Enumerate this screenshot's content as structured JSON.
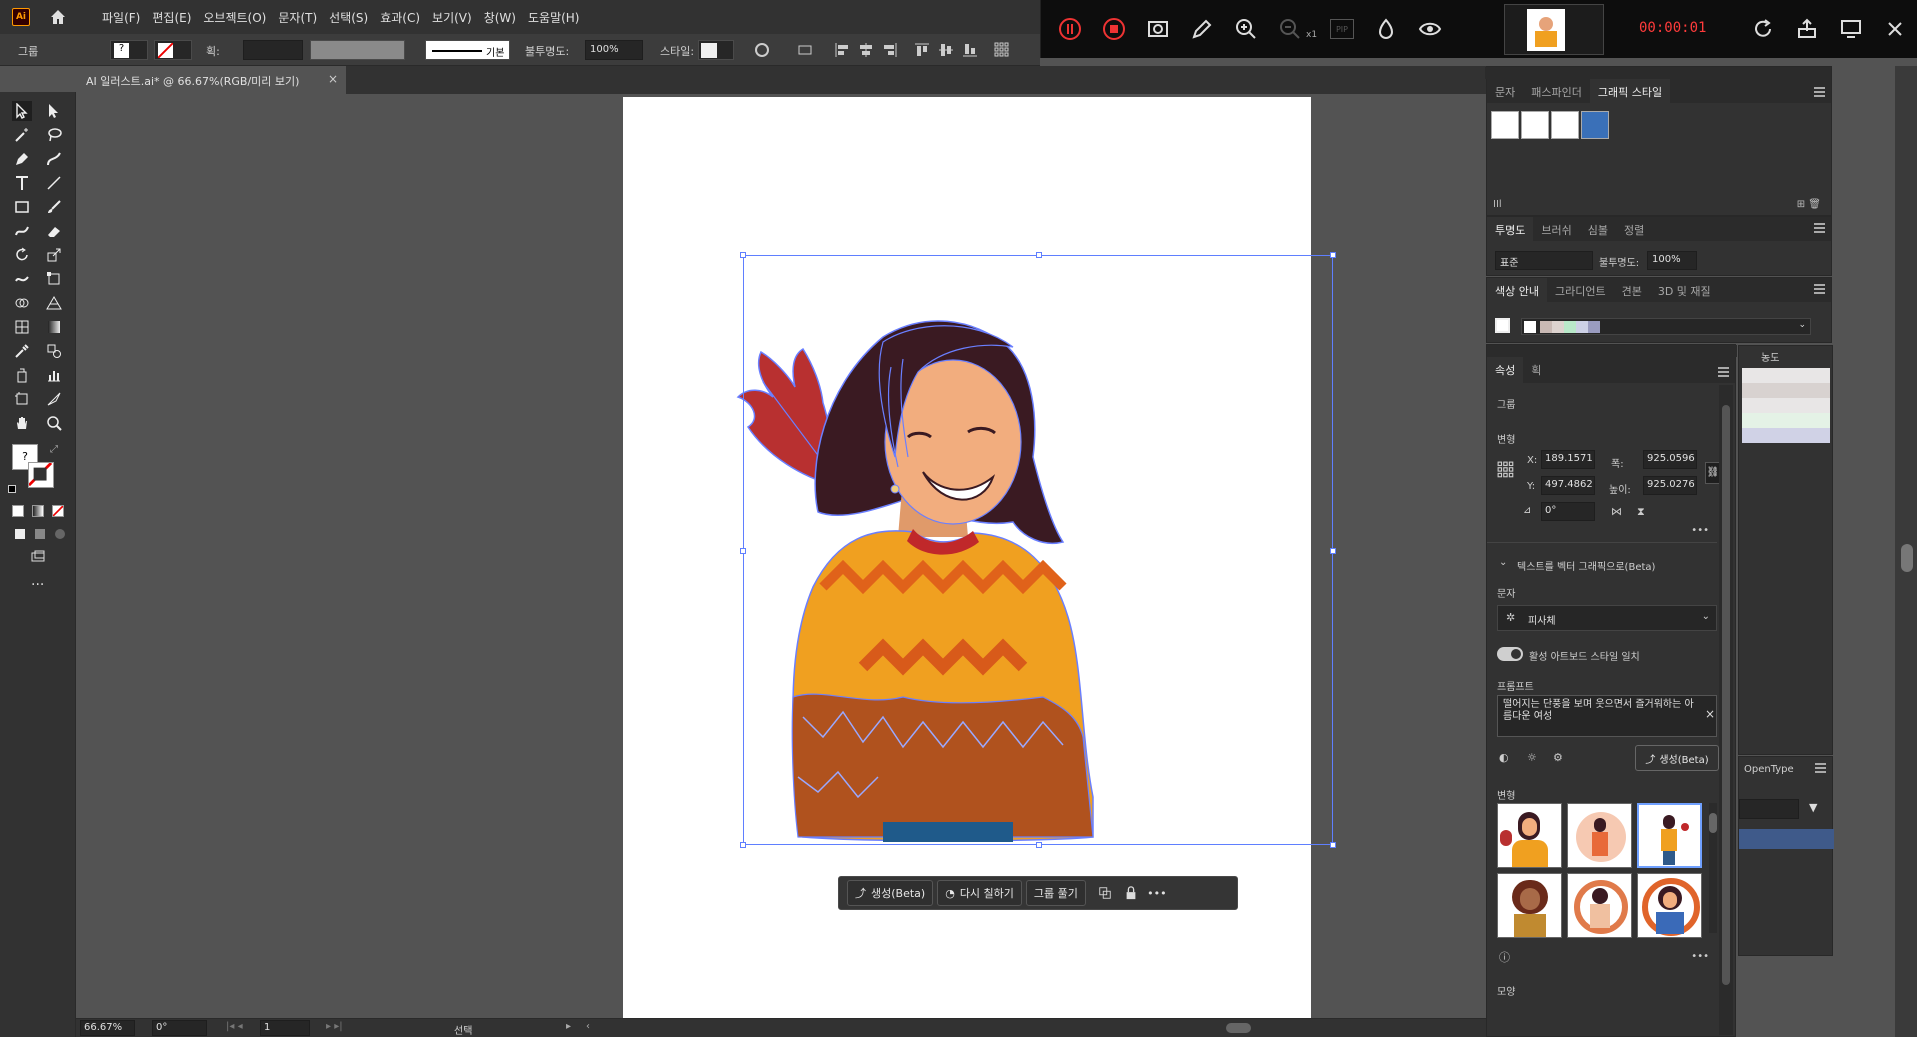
{
  "app": {
    "logo": "Ai",
    "home_icon": "home-icon"
  },
  "menu": [
    "파일(F)",
    "편집(E)",
    "오브젝트(O)",
    "문자(T)",
    "선택(S)",
    "효과(C)",
    "보기(V)",
    "창(W)",
    "도움말(H)"
  ],
  "recorder": {
    "timer": "00:00:01",
    "zoom_suffix": "x1",
    "pip": "PIP"
  },
  "control_bar": {
    "selection": "그룹",
    "stroke_label": "획:",
    "stroke_style": "기본",
    "opacity_label": "불투명도:",
    "opacity": "100%",
    "style_label": "스타일:"
  },
  "document_tab": {
    "title": "AI 일러스트.ai* @ 66.67%(RGB/미리 보기)",
    "close": "×"
  },
  "contextual_taskbar": {
    "generate": "생성(Beta)",
    "recolor": "다시 칠하기",
    "ungroup": "그룹 풀기"
  },
  "status_bar": {
    "zoom": "66.67%",
    "rotation": "0°",
    "artboard": "1",
    "tool": "선택"
  },
  "panels": {
    "graphic_styles": {
      "tabs": [
        "문자",
        "패스파인더",
        "그래픽 스타일"
      ],
      "active_tab": "그래픽 스타일"
    },
    "transparency": {
      "tabs": [
        "투명도",
        "브러쉬",
        "심볼",
        "정렬"
      ],
      "blend_mode": "표준",
      "opacity_label": "불투명도:",
      "opacity": "100%"
    },
    "color_guide": {
      "tabs": [
        "색상 안내",
        "그라디언트",
        "견본",
        "3D 및 재질"
      ],
      "swatches": [
        "#c9b9b4",
        "#ddd3cf",
        "#b9e8c9",
        "#cdd1e6",
        "#9a9cc0"
      ]
    },
    "properties": {
      "tabs": [
        "속성",
        "획"
      ],
      "group_label": "그룹",
      "transform_label": "변형",
      "x_label": "X:",
      "x": "189.1571",
      "y_label": "Y:",
      "y": "497.4862",
      "w_label": "폭:",
      "w": "925.0596",
      "h_label": "높이:",
      "h": "925.0276",
      "angle": "0°",
      "text_to_vector": "텍스트를 벡터 그래픽으로(Beta)",
      "type_label": "문자",
      "type_value": "피사체",
      "match_style": "활성 아트보드 스타일 일치",
      "prompt_label": "프롬프트",
      "prompt": "떨어지는 단풍을 보며 웃으면서 즐거워하는 아름다운 여성",
      "generate_button": "생성(Beta)",
      "variations_label": "변형",
      "appearance_label": "모양"
    },
    "behind": {
      "density_label": "농도",
      "opentype_label": "OpenType"
    }
  }
}
